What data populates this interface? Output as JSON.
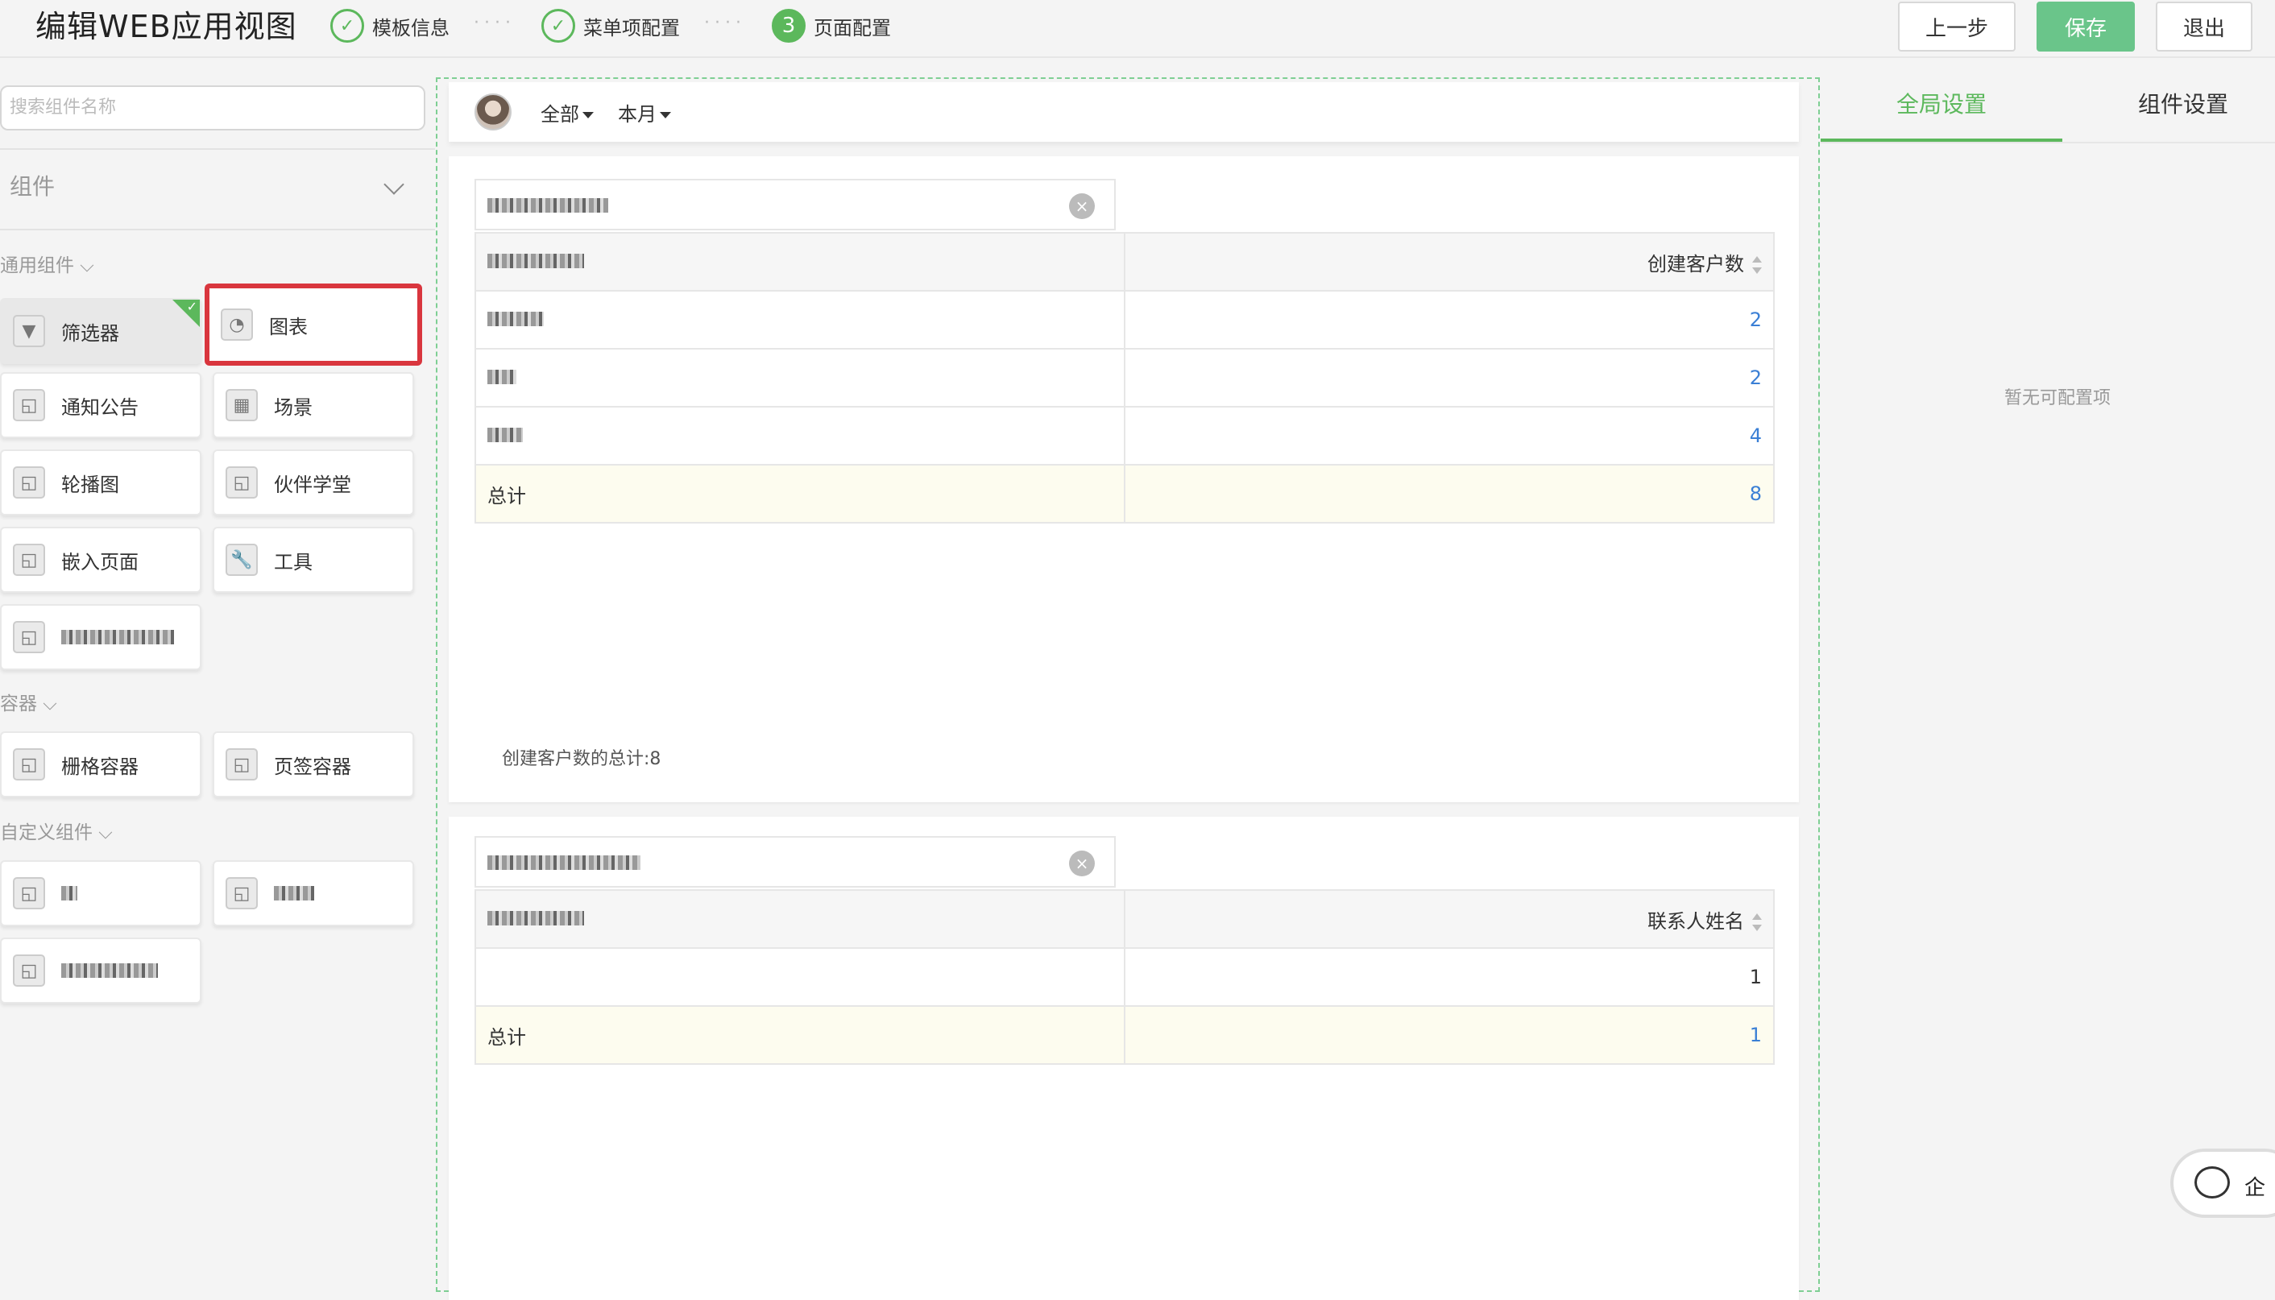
{
  "header": {
    "title": "编辑WEB应用视图",
    "steps": [
      {
        "label": "模板信息",
        "icon": "check-circle-icon"
      },
      {
        "label": "菜单项配置",
        "icon": "check-circle-icon"
      },
      {
        "num": "3",
        "label": "页面配置"
      }
    ],
    "dots": "····",
    "buttons": {
      "prev": "上一步",
      "save": "保存",
      "exit": "退出"
    },
    "colors": {
      "accent": "#5cb85c",
      "save_btn": "#6ac58a"
    }
  },
  "left": {
    "search_placeholder": "搜索组件名称",
    "group_label": "组件",
    "sections": {
      "common": "通用组件",
      "container": "容器",
      "custom": "自定义组件"
    },
    "cards": {
      "filter": "筛选器",
      "chart": "图表",
      "notice": "通知公告",
      "scene": "场景",
      "carousel": "轮播图",
      "academy": "伙伴学堂",
      "embed": "嵌入页面",
      "tools": "工具",
      "grid_container": "栅格容器",
      "tab_container": "页签容器"
    }
  },
  "canvas": {
    "filter_bar": {
      "scope": "全部",
      "period": "本月"
    },
    "table1": {
      "value_header": "创建客户数",
      "rows": [
        "2",
        "2",
        "4"
      ],
      "total_label": "总计",
      "total_value": "8",
      "summary": "创建客户数的总计:8"
    },
    "table2": {
      "value_header": "联系人姓名",
      "rows": [
        "1"
      ],
      "total_label": "总计",
      "total_value": "1"
    }
  },
  "right": {
    "tabs": {
      "global": "全局设置",
      "component": "组件设置"
    },
    "empty_text": "暂无可配置项"
  },
  "chat": {
    "label": "企"
  }
}
